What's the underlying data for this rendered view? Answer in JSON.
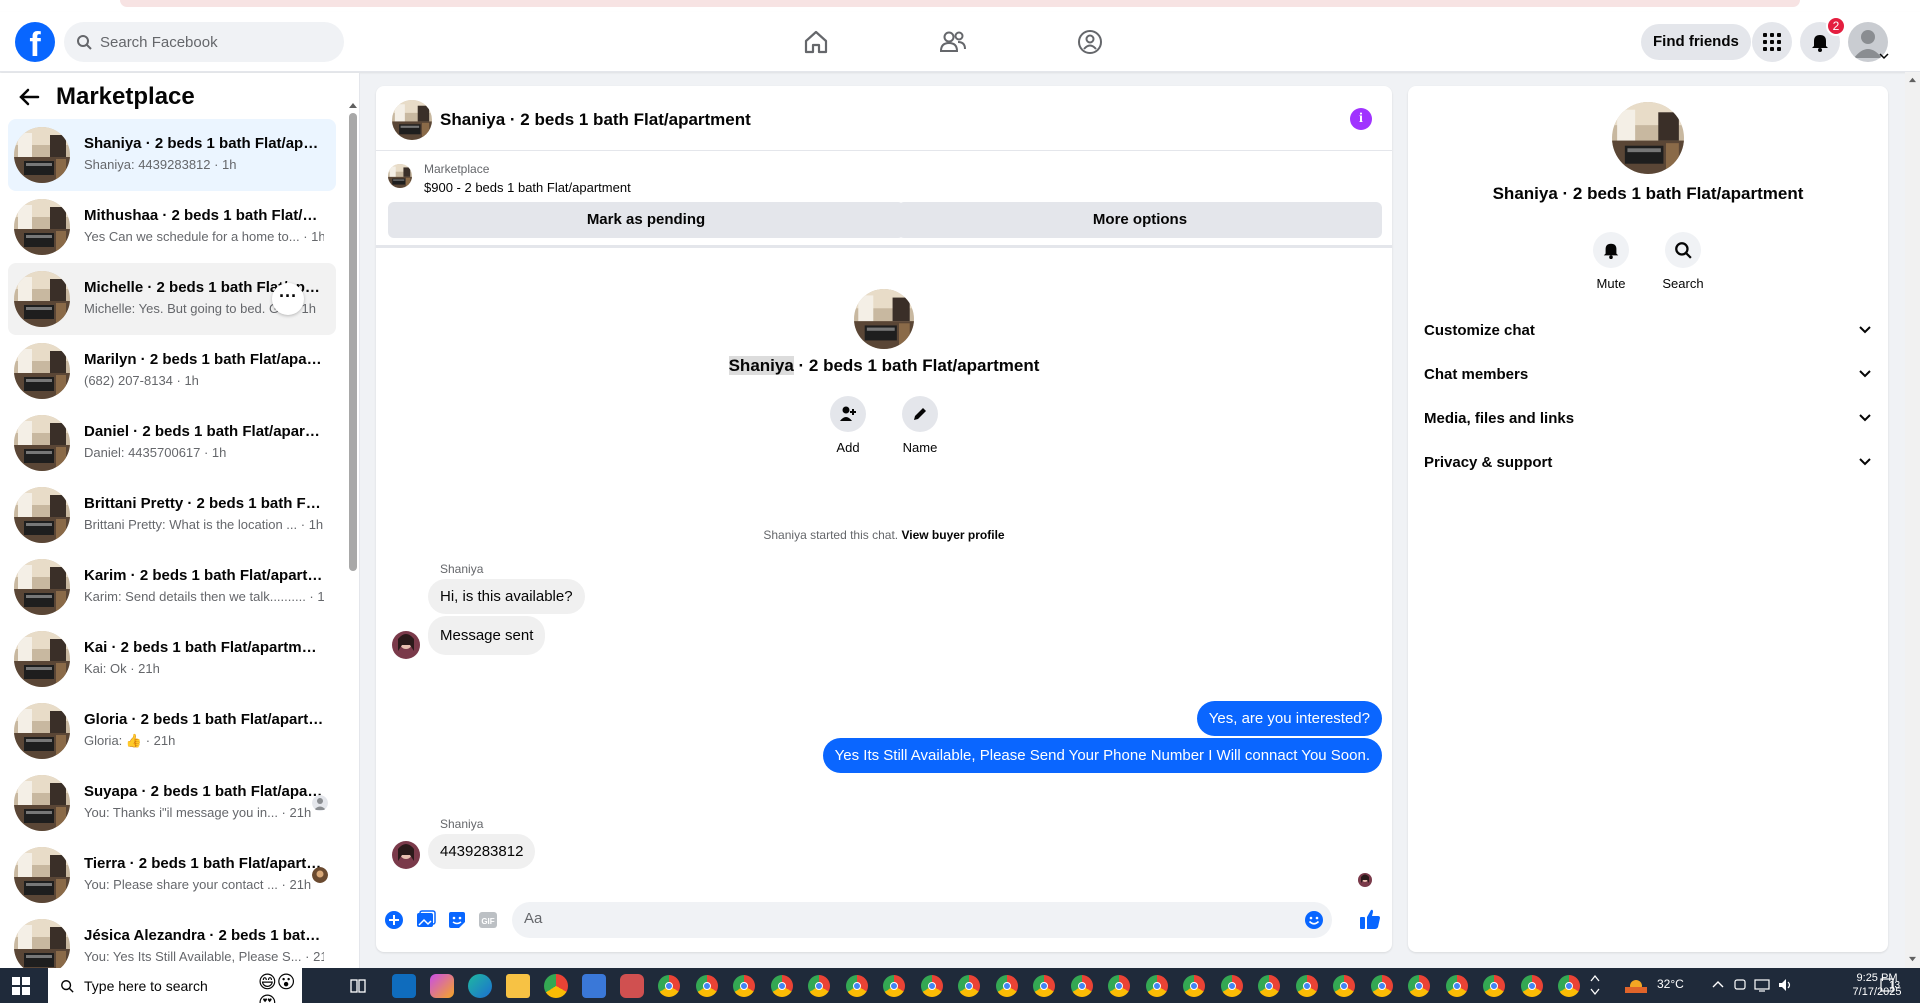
{
  "header": {
    "search_placeholder": "Search Facebook",
    "find_friends_label": "Find friends",
    "notification_count": "2"
  },
  "sidebar": {
    "title": "Marketplace",
    "conversations": [
      {
        "name": "Shaniya · 2 beds 1 bath Flat/apartment",
        "preview": "Shaniya: 4439283812 · 1h"
      },
      {
        "name": "Mithushaa · 2 beds 1 bath Flat/apartment",
        "preview": "Yes Can we schedule for a home to... · 1h"
      },
      {
        "name": "Michelle · 2 beds 1 bath Flat/apartment",
        "preview": "Michelle: Yes. But going to bed. G... · 1h"
      },
      {
        "name": "Marilyn · 2 beds 1 bath Flat/apartment",
        "preview": "(682) 207-8134 · 1h"
      },
      {
        "name": "Daniel · 2 beds 1 bath Flat/apartment",
        "preview": "Daniel: 4435700617 · 1h"
      },
      {
        "name": "Brittani Pretty · 2 beds 1 bath Flat/apartment",
        "preview": "Brittani Pretty: What is the location ... · 1h"
      },
      {
        "name": "Karim · 2 beds 1 bath Flat/apartment",
        "preview": "Karim: Send details then we talk.......... · 1h"
      },
      {
        "name": "Kai · 2 beds 1 bath Flat/apartment",
        "preview": "Kai: Ok · 21h"
      },
      {
        "name": "Gloria · 2 beds 1 bath Flat/apartment",
        "preview": "Gloria: 👍 · 21h"
      },
      {
        "name": "Suyapa · 2 beds 1 bath Flat/apartment",
        "preview": "You: Thanks i\"il message you in... · 21h"
      },
      {
        "name": "Tierra · 2 beds 1 bath Flat/apartment",
        "preview": "You: Please share your contact ... · 21h"
      },
      {
        "name": "Jésica Alezandra · 2 beds 1 bath Flat/apartment",
        "preview": "You: Yes Its Still Available, Please S... · 21h"
      }
    ]
  },
  "chat": {
    "title": "Shaniya · 2 beds 1 bath Flat/apartment",
    "listing_source": "Marketplace",
    "listing_price": "$900 - 2 beds 1 bath Flat/apartment",
    "mark_pending_label": "Mark as pending",
    "more_options_label": "More options",
    "intro_name": "Shaniya",
    "intro_rest": " · 2 beds 1 bath Flat/apartment",
    "add_label": "Add",
    "name_label": "Name",
    "system_text": "Shaniya started this chat. ",
    "system_link": "View buyer profile",
    "messages": [
      {
        "sender": "Shaniya",
        "text": "Hi, is this available?"
      },
      {
        "text": "Message sent"
      },
      {
        "text": "Yes, are you interested?"
      },
      {
        "text": "Yes Its Still Available, Please Send Your Phone Number I Will connact You Soon."
      },
      {
        "sender": "Shaniya",
        "text": "4439283812"
      }
    ],
    "composer_placeholder": "Aa"
  },
  "details": {
    "title": "Shaniya · 2 beds 1 bath Flat/apartment",
    "mute_label": "Mute",
    "search_label": "Search",
    "sections": [
      "Customize chat",
      "Chat members",
      "Media, files and links",
      "Privacy & support"
    ]
  },
  "taskbar": {
    "search_text": "Type here to search",
    "temperature": "32°C",
    "time": "9:25 PM",
    "date": "7/17/2025",
    "notif_count": "13"
  },
  "colors": {
    "brand": "#0866ff",
    "outgoing_bubble": "#0a66ff",
    "info_purple": "#a033ff",
    "badge_red": "#e41e3f"
  }
}
